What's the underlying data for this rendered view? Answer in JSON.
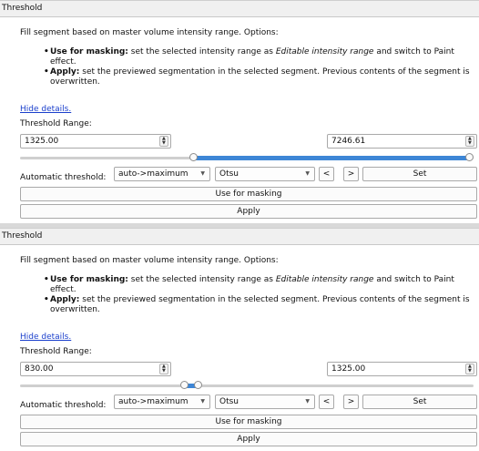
{
  "panels": [
    {
      "header": "Threshold",
      "description": "Fill segment based on master volume intensity range. Options:",
      "bullets": [
        {
          "bold": "Use for masking:",
          "text": " set the selected intensity range as ",
          "italic": "Editable intensity range",
          "text2": " and switch to Paint effect."
        },
        {
          "bold": "Apply:",
          "text": " set the previewed segmentation in the selected segment. Previous contents of the segment is overwritten.",
          "italic": "",
          "text2": ""
        }
      ],
      "hide_details": "Hide details.",
      "threshold_range_label": "Threshold Range:",
      "min_value": "1325.00",
      "max_value": "7246.61",
      "slider": {
        "low_fraction": 0.38,
        "high_fraction": 1.0,
        "color": "#3d86d6"
      },
      "auto_label": "Automatic threshold:",
      "mode_value": "auto->maximum",
      "method_value": "Otsu",
      "prev_label": "<",
      "next_label": ">",
      "set_label": "Set",
      "use_for_masking_label": "Use for masking",
      "apply_label": "Apply"
    },
    {
      "header": "Threshold",
      "description": "Fill segment based on master volume intensity range. Options:",
      "bullets": [
        {
          "bold": "Use for masking:",
          "text": " set the selected intensity range as ",
          "italic": "Editable intensity range",
          "text2": " and switch to Paint effect."
        },
        {
          "bold": "Apply:",
          "text": " set the previewed segmentation in the selected segment. Previous contents of the segment is overwritten.",
          "italic": "",
          "text2": ""
        }
      ],
      "hide_details": "Hide details.",
      "threshold_range_label": "Threshold Range:",
      "min_value": "830.00",
      "max_value": "1325.00",
      "slider": {
        "low_fraction": 0.36,
        "high_fraction": 0.39,
        "color": "#3d86d6"
      },
      "auto_label": "Automatic threshold:",
      "mode_value": "auto->maximum",
      "method_value": "Otsu",
      "prev_label": "<",
      "next_label": ">",
      "set_label": "Set",
      "use_for_masking_label": "Use for masking",
      "apply_label": "Apply"
    }
  ]
}
